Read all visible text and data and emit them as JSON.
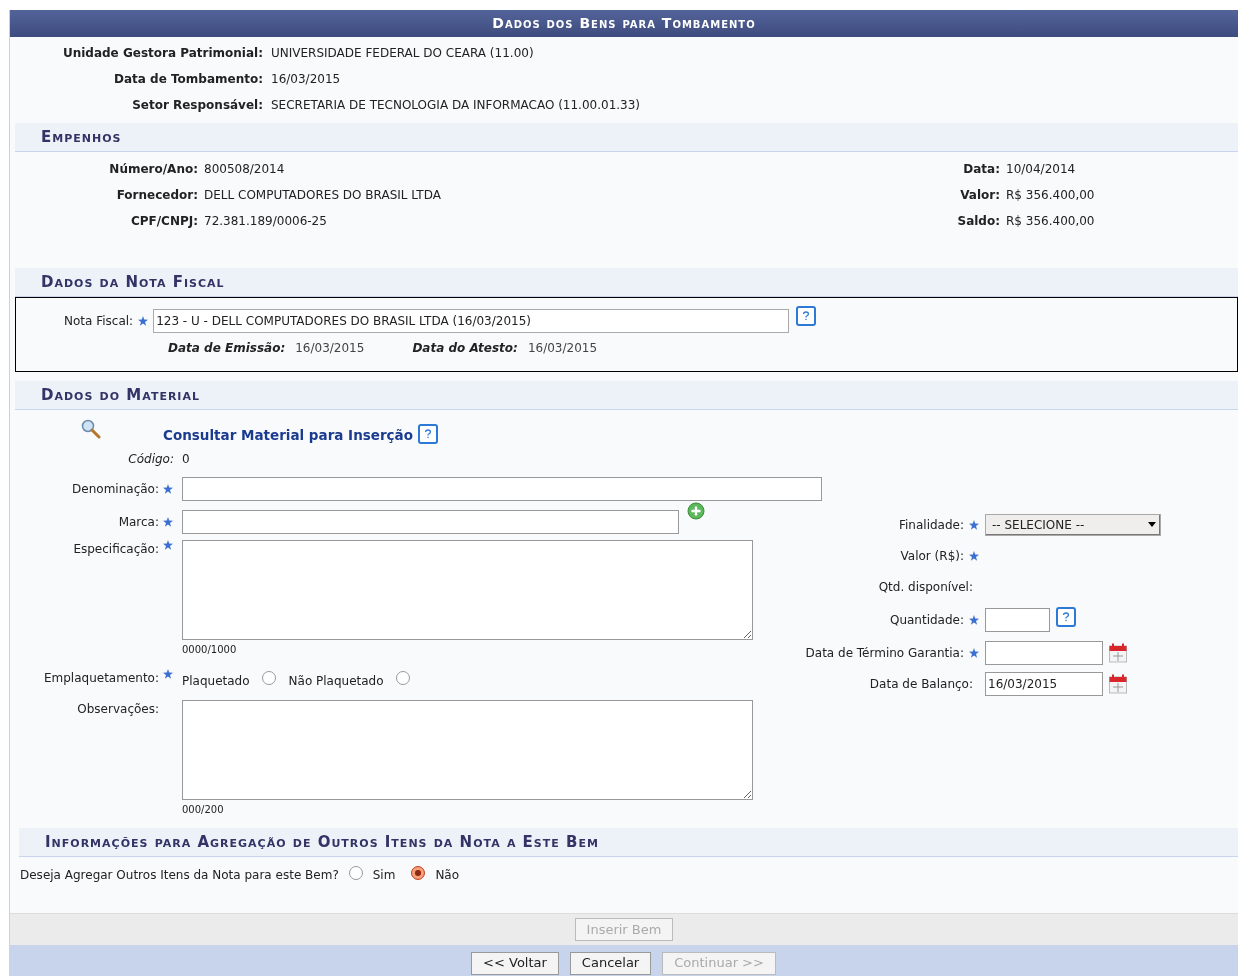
{
  "title": "Dados dos Bens para Tombamento",
  "info": [
    {
      "label": "Unidade Gestora Patrimonial:",
      "value": "UNIVERSIDADE FEDERAL DO CEARA (11.00)"
    },
    {
      "label": "Data de Tombamento:",
      "value": "16/03/2015"
    },
    {
      "label": "Setor Responsável:",
      "value": "SECRETARIA DE TECNOLOGIA DA INFORMACAO (11.00.01.33)"
    }
  ],
  "empenhos": {
    "heading": "Empenhos",
    "left": [
      {
        "label": "Número/Ano:",
        "value": "800508/2014"
      },
      {
        "label": "Fornecedor:",
        "value": "DELL COMPUTADORES DO BRASIL LTDA"
      },
      {
        "label": "CPF/CNPJ:",
        "value": "72.381.189/0006-25"
      }
    ],
    "right": [
      {
        "label": "Data:",
        "value": "10/04/2014"
      },
      {
        "label": "Valor:",
        "value": "R$ 356.400,00"
      },
      {
        "label": "Saldo:",
        "value": "R$ 356.400,00"
      }
    ]
  },
  "nota_fiscal": {
    "heading": "Dados da Nota Fiscal",
    "label": "Nota Fiscal:",
    "required": true,
    "value": "123 - U - DELL COMPUTADORES DO BRASIL LTDA (16/03/2015)",
    "dates": [
      {
        "label": "Data de Emissão:",
        "value": "16/03/2015"
      },
      {
        "label": "Data do Atesto:",
        "value": "16/03/2015"
      }
    ]
  },
  "material": {
    "heading": "Dados do Material",
    "consult_link": "Consultar Material para Inserção",
    "codigo": {
      "label": "Código:",
      "value": "0"
    },
    "left": [
      {
        "kind": "text",
        "label": "Denominação:",
        "required": true,
        "wide": true,
        "add": false
      },
      {
        "kind": "text",
        "label": "Marca:",
        "required": true,
        "wide": false,
        "add": true
      },
      {
        "kind": "textarea",
        "label": "Especificação:",
        "required": true,
        "counter": "0000/1000"
      },
      {
        "kind": "radio",
        "label": "Emplaquetamento:",
        "required": true,
        "options": [
          {
            "label": "Plaquetado",
            "selected": false
          },
          {
            "label": "Não Plaquetado",
            "selected": false
          }
        ]
      },
      {
        "kind": "textarea",
        "label": "Observações:",
        "required": false,
        "counter": "000/200"
      }
    ],
    "right": [
      {
        "kind": "select",
        "label": "Finalidade:",
        "required": true,
        "value": "-- SELECIONE --"
      },
      {
        "kind": "label",
        "label": "Valor (R$):",
        "required": true
      },
      {
        "kind": "label",
        "label": "Qtd. disponível:",
        "required": false
      },
      {
        "kind": "number",
        "label": "Quantidade:",
        "required": true
      },
      {
        "kind": "date",
        "label": "Data de Término Garantia:",
        "required": true
      },
      {
        "kind": "date",
        "label": "Data de Balanço:",
        "required": false,
        "value": "16/03/2015"
      }
    ]
  },
  "agregacao": {
    "heading": "Informações para Agregação de Outros Itens da Nota a Este Bem",
    "question": "Deseja Agregar Outros Itens da Nota para este Bem?",
    "options": [
      {
        "label": "Sim",
        "selected": false
      },
      {
        "label": "Não",
        "selected": true
      }
    ]
  },
  "insert_button": {
    "label": "Inserir Bem",
    "disabled": true
  },
  "nav_buttons": [
    {
      "label": "<< Voltar",
      "disabled": false
    },
    {
      "label": "Cancelar",
      "disabled": false
    },
    {
      "label": "Continuar >>",
      "disabled": true
    }
  ]
}
